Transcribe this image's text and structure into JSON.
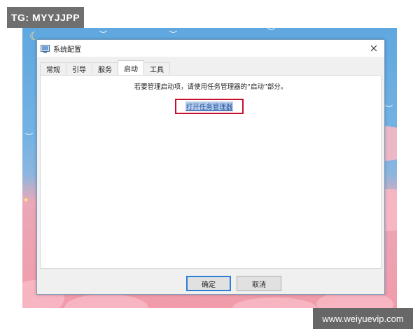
{
  "watermarks": {
    "top_left": "TG: MYYJJPP",
    "bottom_right": "www.weiyuevip.com"
  },
  "window": {
    "title": "系统配置",
    "app_icon": "system-config-icon",
    "close_icon": "close-icon"
  },
  "tabs": [
    {
      "label": "常规",
      "active": false
    },
    {
      "label": "引导",
      "active": false
    },
    {
      "label": "服务",
      "active": false
    },
    {
      "label": "启动",
      "active": true
    },
    {
      "label": "工具",
      "active": false
    }
  ],
  "panel": {
    "instruction": "若要管理启动项，请使用任务管理器的“启动”部分。",
    "link_label": "打开任务管理器"
  },
  "buttons": {
    "ok": "确定",
    "cancel": "取消"
  },
  "colors": {
    "highlight_border": "#c8102e",
    "link": "#1a4fa0",
    "accent": "#2f7fd6"
  }
}
